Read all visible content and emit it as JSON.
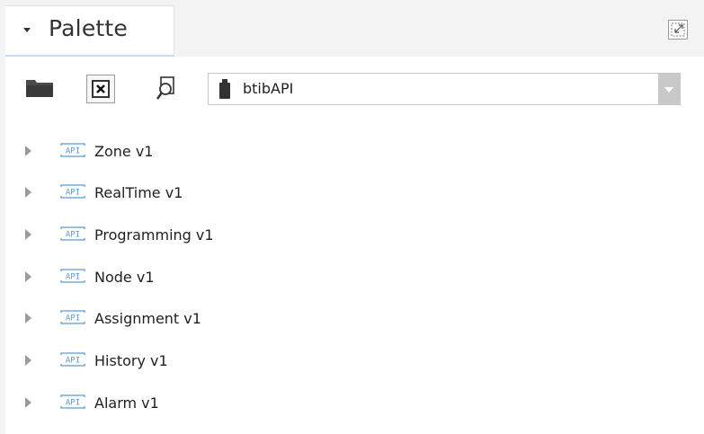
{
  "palette": {
    "title": "Palette"
  },
  "toolbar": {
    "icons": [
      "folder-icon",
      "close-icon",
      "find-icon"
    ]
  },
  "module_select": {
    "value": "btibAPI",
    "icon": "module-jar-icon"
  },
  "tree": {
    "items": [
      {
        "label": "Zone v1",
        "icon": "api-icon"
      },
      {
        "label": "RealTime v1",
        "icon": "api-icon"
      },
      {
        "label": "Programming v1",
        "icon": "api-icon"
      },
      {
        "label": "Node v1",
        "icon": "api-icon"
      },
      {
        "label": "Assignment v1",
        "icon": "api-icon"
      },
      {
        "label": "History v1",
        "icon": "api-icon"
      },
      {
        "label": "Alarm v1",
        "icon": "api-icon"
      }
    ]
  },
  "colors": {
    "accent": "#c9dbef",
    "api_icon": "#5b9bd5",
    "background": "#f3f3f3"
  }
}
